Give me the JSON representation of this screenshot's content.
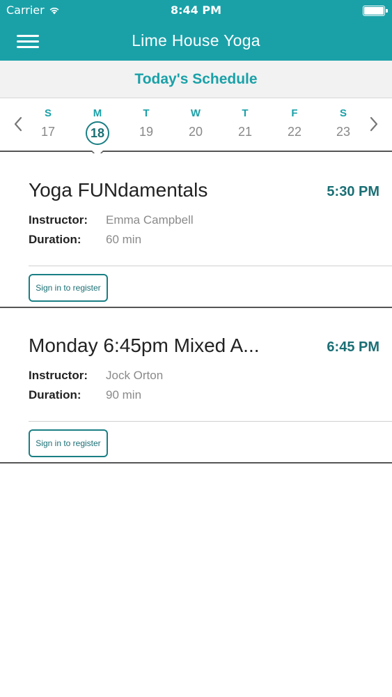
{
  "status_bar": {
    "carrier": "Carrier",
    "time": "8:44 PM",
    "wifi_icon": "wifi-icon",
    "battery_icon": "battery-icon"
  },
  "header": {
    "title": "Lime House Yoga",
    "menu_icon": "hamburger-menu-icon"
  },
  "schedule": {
    "title": "Today's Schedule"
  },
  "week": {
    "prev_icon": "chevron-left-icon",
    "next_icon": "chevron-right-icon",
    "days": [
      {
        "dow": "S",
        "date": "17"
      },
      {
        "dow": "M",
        "date": "18",
        "selected": true
      },
      {
        "dow": "T",
        "date": "19"
      },
      {
        "dow": "W",
        "date": "20"
      },
      {
        "dow": "T",
        "date": "21"
      },
      {
        "dow": "F",
        "date": "22"
      },
      {
        "dow": "S",
        "date": "23"
      }
    ]
  },
  "classes": [
    {
      "name": "Yoga FUNdamentals",
      "time": "5:30 PM",
      "instructor_label": "Instructor:",
      "instructor": "Emma Campbell",
      "duration_label": "Duration:",
      "duration": "60 min",
      "register_label": "Sign in to register"
    },
    {
      "name": "Monday 6:45pm Mixed A...",
      "time": "6:45 PM",
      "instructor_label": "Instructor:",
      "instructor": "Jock Orton",
      "duration_label": "Duration:",
      "duration": "90 min",
      "register_label": "Sign in to register"
    }
  ],
  "colors": {
    "brand": "#1aa1a8",
    "accent_dark": "#1a6f74",
    "muted_text": "#8a8a8a",
    "section_bg": "#f2f2f2"
  }
}
